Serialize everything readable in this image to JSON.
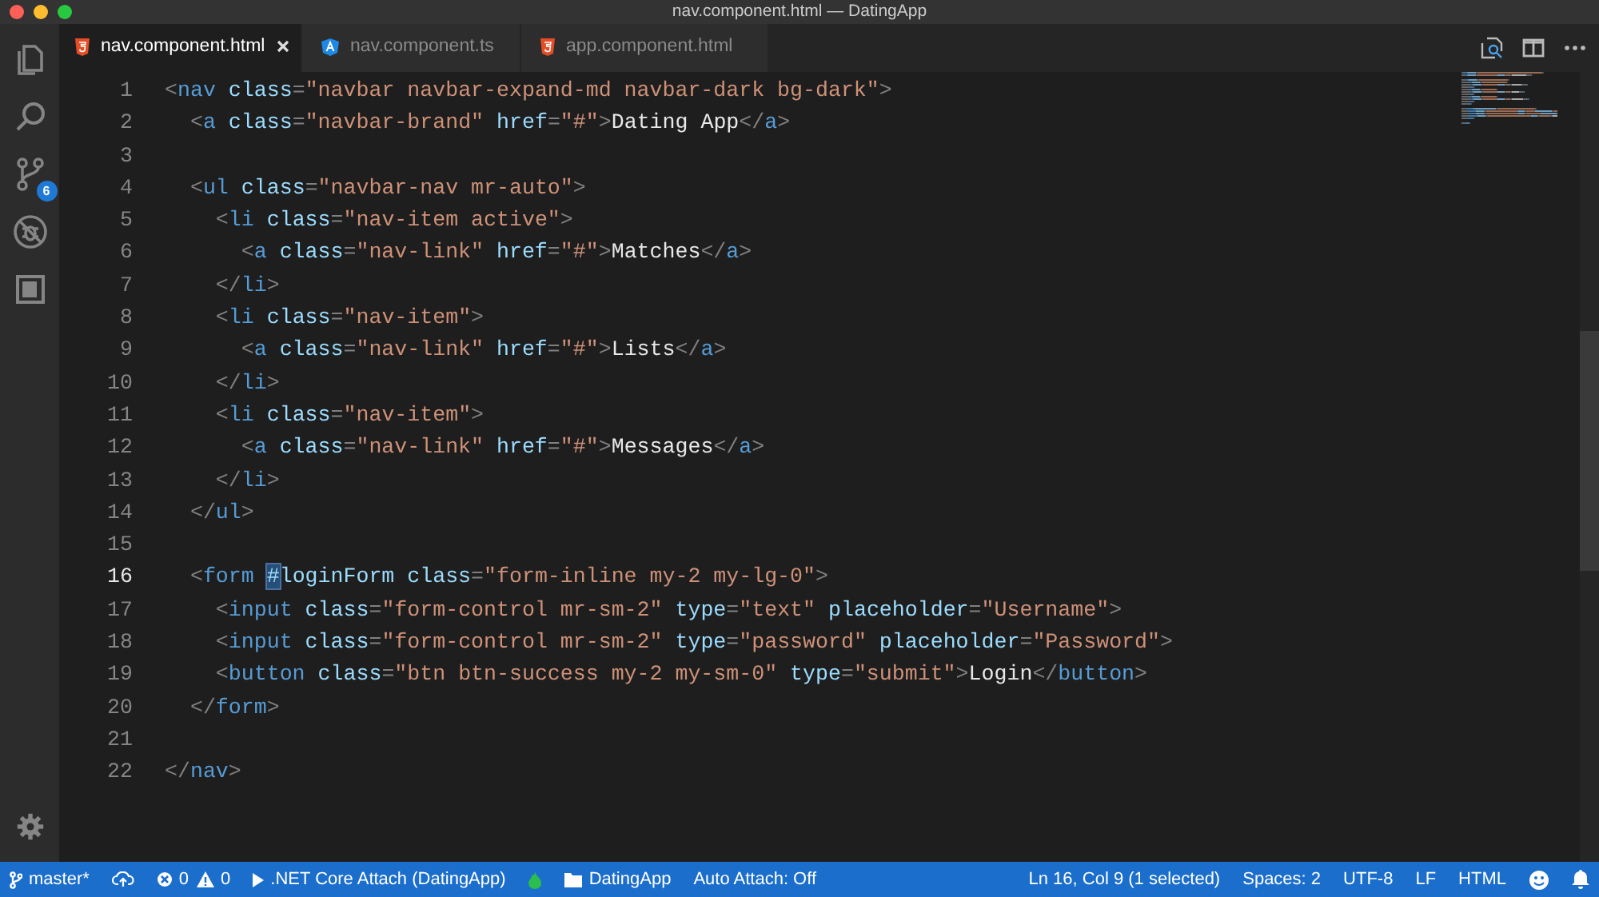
{
  "window": {
    "title": "nav.component.html — DatingApp"
  },
  "activity_bar": {
    "items": [
      {
        "kind": "files",
        "selected": false
      },
      {
        "kind": "search",
        "selected": false
      },
      {
        "kind": "git",
        "selected": false,
        "badge": "6"
      },
      {
        "kind": "debug",
        "selected": false
      },
      {
        "kind": "extensions",
        "selected": false
      }
    ],
    "bottom": {
      "kind": "settings"
    }
  },
  "tabs": [
    {
      "label": "nav.component.html",
      "kind": "html",
      "selected": true
    },
    {
      "label": "nav.component.ts",
      "kind": "angular",
      "selected": false
    },
    {
      "label": "app.component.html",
      "kind": "html",
      "selected": false
    }
  ],
  "editor": {
    "lines": [
      {
        "number": "1",
        "current": false,
        "tokens": [
          {
            "kind": "p",
            "text": "<"
          },
          {
            "kind": "tag",
            "text": "nav"
          },
          {
            "kind": "a",
            "text": " class"
          },
          {
            "kind": "p",
            "text": "="
          },
          {
            "kind": "s",
            "text": "\"navbar navbar-expand-md navbar-dark bg-dark\""
          },
          {
            "kind": "p",
            "text": ">"
          }
        ]
      },
      {
        "number": "2",
        "current": false,
        "tokens": [
          {
            "kind": "p",
            "text": "  <"
          },
          {
            "kind": "tag",
            "text": "a"
          },
          {
            "kind": "a",
            "text": " class"
          },
          {
            "kind": "p",
            "text": "="
          },
          {
            "kind": "s",
            "text": "\"navbar-brand\""
          },
          {
            "kind": "a",
            "text": " href"
          },
          {
            "kind": "p",
            "text": "="
          },
          {
            "kind": "s",
            "text": "\"#\""
          },
          {
            "kind": "p",
            "text": ">"
          },
          {
            "kind": "x",
            "text": "Dating App"
          },
          {
            "kind": "p",
            "text": "</"
          },
          {
            "kind": "tag",
            "text": "a"
          },
          {
            "kind": "p",
            "text": ">"
          }
        ]
      },
      {
        "number": "3",
        "current": false
      },
      {
        "number": "4",
        "current": false,
        "tokens": [
          {
            "kind": "p",
            "text": "  <"
          },
          {
            "kind": "tag",
            "text": "ul"
          },
          {
            "kind": "a",
            "text": " class"
          },
          {
            "kind": "p",
            "text": "="
          },
          {
            "kind": "s",
            "text": "\"navbar-nav mr-auto\""
          },
          {
            "kind": "p",
            "text": ">"
          }
        ]
      },
      {
        "number": "5",
        "current": false,
        "tokens": [
          {
            "kind": "p",
            "text": "    <"
          },
          {
            "kind": "tag",
            "text": "li"
          },
          {
            "kind": "a",
            "text": " class"
          },
          {
            "kind": "p",
            "text": "="
          },
          {
            "kind": "s",
            "text": "\"nav-item active\""
          },
          {
            "kind": "p",
            "text": ">"
          }
        ]
      },
      {
        "number": "6",
        "current": false,
        "tokens": [
          {
            "kind": "p",
            "text": "      <"
          },
          {
            "kind": "tag",
            "text": "a"
          },
          {
            "kind": "a",
            "text": " class"
          },
          {
            "kind": "p",
            "text": "="
          },
          {
            "kind": "s",
            "text": "\"nav-link\""
          },
          {
            "kind": "a",
            "text": " href"
          },
          {
            "kind": "p",
            "text": "="
          },
          {
            "kind": "s",
            "text": "\"#\""
          },
          {
            "kind": "p",
            "text": ">"
          },
          {
            "kind": "x",
            "text": "Matches"
          },
          {
            "kind": "p",
            "text": "</"
          },
          {
            "kind": "tag",
            "text": "a"
          },
          {
            "kind": "p",
            "text": ">"
          }
        ]
      },
      {
        "number": "7",
        "current": false,
        "tokens": [
          {
            "kind": "p",
            "text": "    </"
          },
          {
            "kind": "tag",
            "text": "li"
          },
          {
            "kind": "p",
            "text": ">"
          }
        ]
      },
      {
        "number": "8",
        "current": false,
        "tokens": [
          {
            "kind": "p",
            "text": "    <"
          },
          {
            "kind": "tag",
            "text": "li"
          },
          {
            "kind": "a",
            "text": " class"
          },
          {
            "kind": "p",
            "text": "="
          },
          {
            "kind": "s",
            "text": "\"nav-item\""
          },
          {
            "kind": "p",
            "text": ">"
          }
        ]
      },
      {
        "number": "9",
        "current": false,
        "tokens": [
          {
            "kind": "p",
            "text": "      <"
          },
          {
            "kind": "tag",
            "text": "a"
          },
          {
            "kind": "a",
            "text": " class"
          },
          {
            "kind": "p",
            "text": "="
          },
          {
            "kind": "s",
            "text": "\"nav-link\""
          },
          {
            "kind": "a",
            "text": " href"
          },
          {
            "kind": "p",
            "text": "="
          },
          {
            "kind": "s",
            "text": "\"#\""
          },
          {
            "kind": "p",
            "text": ">"
          },
          {
            "kind": "x",
            "text": "Lists"
          },
          {
            "kind": "p",
            "text": "</"
          },
          {
            "kind": "tag",
            "text": "a"
          },
          {
            "kind": "p",
            "text": ">"
          }
        ]
      },
      {
        "number": "10",
        "current": false,
        "tokens": [
          {
            "kind": "p",
            "text": "    </"
          },
          {
            "kind": "tag",
            "text": "li"
          },
          {
            "kind": "p",
            "text": ">"
          }
        ]
      },
      {
        "number": "11",
        "current": false,
        "tokens": [
          {
            "kind": "p",
            "text": "    <"
          },
          {
            "kind": "tag",
            "text": "li"
          },
          {
            "kind": "a",
            "text": " class"
          },
          {
            "kind": "p",
            "text": "="
          },
          {
            "kind": "s",
            "text": "\"nav-item\""
          },
          {
            "kind": "p",
            "text": ">"
          }
        ]
      },
      {
        "number": "12",
        "current": false,
        "tokens": [
          {
            "kind": "p",
            "text": "      <"
          },
          {
            "kind": "tag",
            "text": "a"
          },
          {
            "kind": "a",
            "text": " class"
          },
          {
            "kind": "p",
            "text": "="
          },
          {
            "kind": "s",
            "text": "\"nav-link\""
          },
          {
            "kind": "a",
            "text": " href"
          },
          {
            "kind": "p",
            "text": "="
          },
          {
            "kind": "s",
            "text": "\"#\""
          },
          {
            "kind": "p",
            "text": ">"
          },
          {
            "kind": "x",
            "text": "Messages"
          },
          {
            "kind": "p",
            "text": "</"
          },
          {
            "kind": "tag",
            "text": "a"
          },
          {
            "kind": "p",
            "text": ">"
          }
        ]
      },
      {
        "number": "13",
        "current": false,
        "tokens": [
          {
            "kind": "p",
            "text": "    </"
          },
          {
            "kind": "tag",
            "text": "li"
          },
          {
            "kind": "p",
            "text": ">"
          }
        ]
      },
      {
        "number": "14",
        "current": false,
        "tokens": [
          {
            "kind": "p",
            "text": "  </"
          },
          {
            "kind": "tag",
            "text": "ul"
          },
          {
            "kind": "p",
            "text": ">"
          }
        ]
      },
      {
        "number": "15",
        "current": false
      },
      {
        "number": "16",
        "current": true,
        "tokens": [
          {
            "kind": "p",
            "text": "  <"
          },
          {
            "kind": "tag",
            "text": "form "
          },
          {
            "kind": "sel",
            "text": "#"
          },
          {
            "kind": "a",
            "text": "loginForm class"
          },
          {
            "kind": "p",
            "text": "="
          },
          {
            "kind": "s",
            "text": "\"form-inline my-2 my-lg-0\""
          },
          {
            "kind": "p",
            "text": ">"
          }
        ]
      },
      {
        "number": "17",
        "current": false,
        "tokens": [
          {
            "kind": "p",
            "text": "    <"
          },
          {
            "kind": "tag",
            "text": "input"
          },
          {
            "kind": "a",
            "text": " class"
          },
          {
            "kind": "p",
            "text": "="
          },
          {
            "kind": "s",
            "text": "\"form-control mr-sm-2\""
          },
          {
            "kind": "a",
            "text": " type"
          },
          {
            "kind": "p",
            "text": "="
          },
          {
            "kind": "s",
            "text": "\"text\""
          },
          {
            "kind": "a",
            "text": " placeholder"
          },
          {
            "kind": "p",
            "text": "="
          },
          {
            "kind": "s",
            "text": "\"Username\""
          },
          {
            "kind": "p",
            "text": ">"
          }
        ]
      },
      {
        "number": "18",
        "current": false,
        "tokens": [
          {
            "kind": "p",
            "text": "    <"
          },
          {
            "kind": "tag",
            "text": "input"
          },
          {
            "kind": "a",
            "text": " class"
          },
          {
            "kind": "p",
            "text": "="
          },
          {
            "kind": "s",
            "text": "\"form-control mr-sm-2\""
          },
          {
            "kind": "a",
            "text": " type"
          },
          {
            "kind": "p",
            "text": "="
          },
          {
            "kind": "s",
            "text": "\"password\""
          },
          {
            "kind": "a",
            "text": " placeholder"
          },
          {
            "kind": "p",
            "text": "="
          },
          {
            "kind": "s",
            "text": "\"Password\""
          },
          {
            "kind": "p",
            "text": ">"
          }
        ]
      },
      {
        "number": "19",
        "current": false,
        "tokens": [
          {
            "kind": "p",
            "text": "    <"
          },
          {
            "kind": "tag",
            "text": "button"
          },
          {
            "kind": "a",
            "text": " class"
          },
          {
            "kind": "p",
            "text": "="
          },
          {
            "kind": "s",
            "text": "\"btn btn-success my-2 my-sm-0\""
          },
          {
            "kind": "a",
            "text": " type"
          },
          {
            "kind": "p",
            "text": "="
          },
          {
            "kind": "s",
            "text": "\"submit\""
          },
          {
            "kind": "p",
            "text": ">"
          },
          {
            "kind": "x",
            "text": "Login"
          },
          {
            "kind": "p",
            "text": "</"
          },
          {
            "kind": "tag",
            "text": "button"
          },
          {
            "kind": "p",
            "text": ">"
          }
        ]
      },
      {
        "number": "20",
        "current": false,
        "tokens": [
          {
            "kind": "p",
            "text": "  </"
          },
          {
            "kind": "tag",
            "text": "form"
          },
          {
            "kind": "p",
            "text": ">"
          }
        ]
      },
      {
        "number": "21",
        "current": false
      },
      {
        "number": "22",
        "current": false,
        "tokens": [
          {
            "kind": "p",
            "text": "</"
          },
          {
            "kind": "tag",
            "text": "nav"
          },
          {
            "kind": "p",
            "text": ">"
          }
        ]
      }
    ]
  },
  "status_bar": {
    "left": [
      {
        "kind": "branch",
        "text": "master*"
      },
      {
        "kind": "sync"
      },
      {
        "kind": "errors",
        "text": "0"
      },
      {
        "kind": "warnings",
        "text": "0"
      },
      {
        "kind": "run",
        "text": ".NET Core Attach (DatingApp)"
      },
      {
        "kind": "flame"
      },
      {
        "kind": "folder",
        "text": "DatingApp"
      },
      {
        "kind": "plain",
        "text": "Auto Attach: Off"
      }
    ],
    "right": [
      {
        "kind": "plain",
        "text": "Ln 16, Col 9 (1 selected)"
      },
      {
        "kind": "plain",
        "text": "Spaces: 2"
      },
      {
        "kind": "plain",
        "text": "UTF-8"
      },
      {
        "kind": "plain",
        "text": "LF"
      },
      {
        "kind": "plain",
        "text": "HTML"
      },
      {
        "kind": "smiley"
      },
      {
        "kind": "bell"
      }
    ]
  }
}
